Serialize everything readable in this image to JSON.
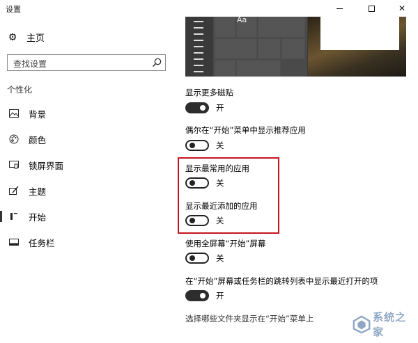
{
  "window": {
    "title": "设置"
  },
  "sidebar": {
    "home_label": "主页",
    "search_placeholder": "查找设置",
    "section_title": "个性化",
    "items": [
      {
        "label": "背景",
        "icon": "image-icon"
      },
      {
        "label": "颜色",
        "icon": "palette-icon"
      },
      {
        "label": "锁屏界面",
        "icon": "lockscreen-icon"
      },
      {
        "label": "主题",
        "icon": "theme-icon"
      },
      {
        "label": "开始",
        "icon": "start-icon",
        "active": true
      },
      {
        "label": "任务栏",
        "icon": "taskbar-icon"
      }
    ]
  },
  "preview": {
    "tile_text": "Aa"
  },
  "settings": [
    {
      "label": "显示更多磁贴",
      "state": "开",
      "on": true
    },
    {
      "label": "偶尔在“开始”菜单中显示推荐应用",
      "state": "关",
      "on": false
    },
    {
      "label": "显示最常用的应用",
      "state": "关",
      "on": false
    },
    {
      "label": "显示最近添加的应用",
      "state": "关",
      "on": false
    },
    {
      "label": "使用全屏幕“开始”屏幕",
      "state": "关",
      "on": false
    },
    {
      "label": "在“开始”屏幕或任务栏的跳转列表中显示最近打开的项",
      "state": "开",
      "on": true
    }
  ],
  "folders_link": "选择哪些文件夹显示在“开始”菜单上",
  "watermark": {
    "text": "系统之家"
  },
  "colors": {
    "highlight_border": "#c8121f",
    "toggle_on": "#2d2d2d"
  }
}
